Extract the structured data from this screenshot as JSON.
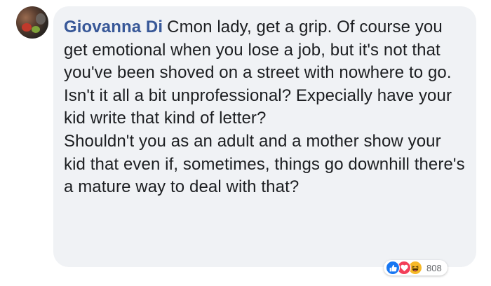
{
  "comment": {
    "author": "Giovanna Di",
    "text_paragraph_1": "Cmon lady, get a grip. Of course you get emotional when you lose a job, but it's not that you've been shoved on a street with nowhere to go. Isn't it all a bit unprofessional? Expecially have your kid write that kind of letter?",
    "text_paragraph_2": "Shouldn't you as an adult and a mother show your kid that even if, sometimes, things go downhill there's a mature way to deal with that?"
  },
  "reactions": {
    "icons": [
      "like-icon",
      "love-icon",
      "haha-icon"
    ],
    "count": "808",
    "colors": {
      "like": "#1877f2",
      "love": "#f33e58",
      "haha": "#f7b928"
    }
  },
  "colors": {
    "author_link": "#385898",
    "bubble_bg": "#f0f2f5",
    "text": "#1c1e21"
  }
}
